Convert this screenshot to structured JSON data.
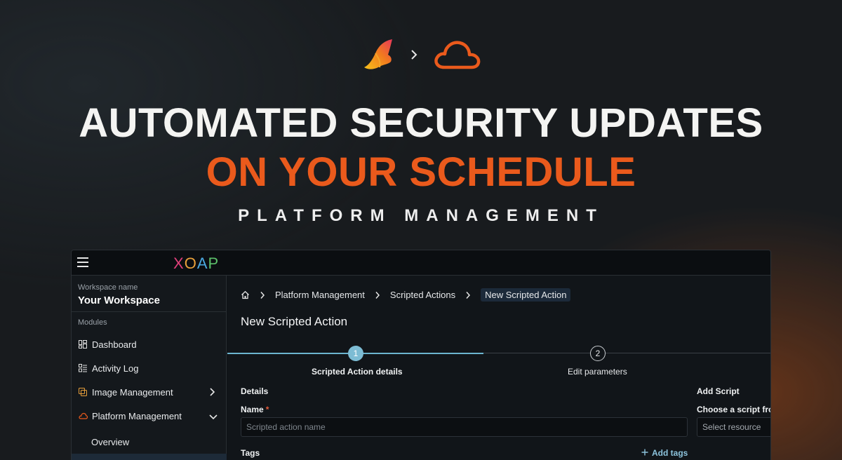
{
  "hero": {
    "logo_left_icon": "butterfly-logo",
    "logo_arrow_icon": "chevron-right",
    "logo_right_icon": "cloud-icon",
    "headline_line1": "AUTOMATED SECURITY UPDATES",
    "headline_line2": "ON YOUR SCHEDULE",
    "subline": "PLATFORM MANAGEMENT",
    "accent_color": "#ea5a1c"
  },
  "app": {
    "brand": [
      "X",
      "O",
      "A",
      "P"
    ],
    "brand_colors": [
      "#e0407a",
      "#e9a03a",
      "#4aa8e0",
      "#5cc06a"
    ],
    "workspace_label": "Workspace name",
    "workspace_name": "Your Workspace",
    "modules_label": "Modules",
    "nav": {
      "dashboard": "Dashboard",
      "activity_log": "Activity Log",
      "image_management": "Image Management",
      "platform_management": "Platform Management",
      "overview": "Overview"
    },
    "breadcrumb": {
      "item1": "Platform Management",
      "item2": "Scripted Actions",
      "current": "New Scripted Action"
    },
    "page_title": "New Scripted Action",
    "steps": {
      "step1_number": "1",
      "step1_label": "Scripted Action details",
      "step2_number": "2",
      "step2_label": "Edit parameters"
    },
    "form": {
      "details_heading": "Details",
      "name_label": "Name",
      "required_mark": "*",
      "name_placeholder": "Scripted action name",
      "name_value": "",
      "tags_label": "Tags",
      "add_tags_label": "Add tags",
      "add_script_heading": "Add Script",
      "choose_script_label": "Choose a script from",
      "select_placeholder": "Select resource"
    }
  }
}
